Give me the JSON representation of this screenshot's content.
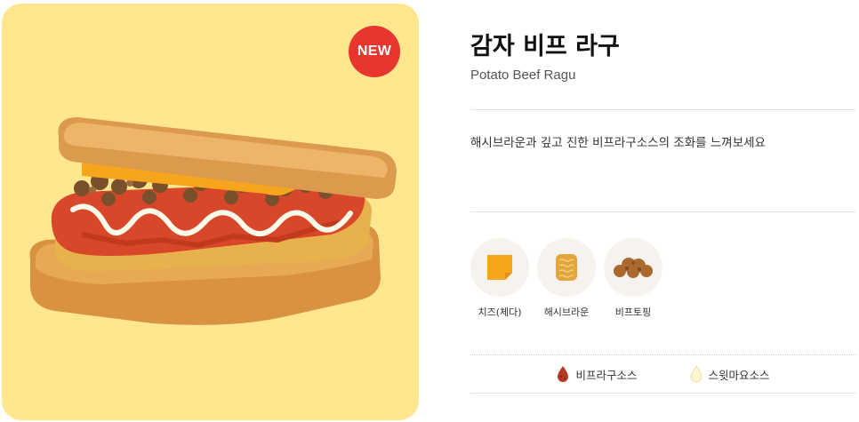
{
  "product": {
    "badge": "NEW",
    "title": "감자 비프 라구",
    "subtitle": "Potato Beef Ragu",
    "description": "해시브라운과 깊고 진한 비프라구소스의 조화를 느껴보세요"
  },
  "ingredients": [
    {
      "label": "치즈(체다)",
      "icon": "cheese-slice-icon"
    },
    {
      "label": "해시브라운",
      "icon": "hashbrown-icon"
    },
    {
      "label": "비프토핑",
      "icon": "beef-topping-icon"
    }
  ],
  "sauces": [
    {
      "label": "비프라구소스",
      "icon": "ragu-sauce-drop-icon",
      "color": "#b43a22"
    },
    {
      "label": "스윗마요소스",
      "icon": "sweet-mayo-drop-icon",
      "color": "#fff6cf"
    }
  ],
  "colors": {
    "card_background": "#ffe68f",
    "badge": "#e8362f",
    "ingredient_circle": "#f6f3ef"
  }
}
